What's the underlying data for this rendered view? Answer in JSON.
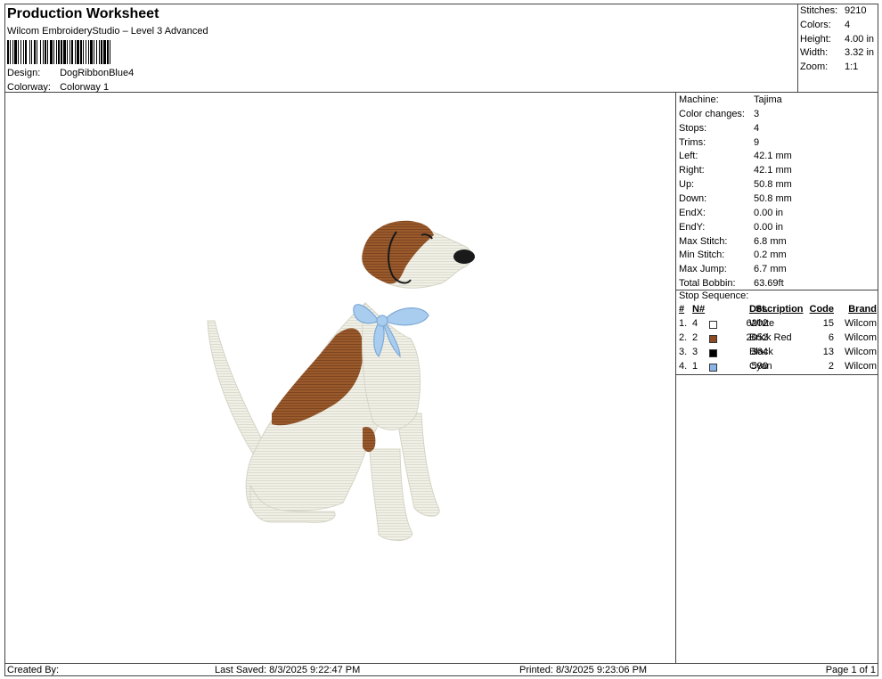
{
  "header": {
    "title": "Production Worksheet",
    "subtitle": "Wilcom EmbroideryStudio – Level 3 Advanced",
    "design_label": "Design:",
    "design_value": "DogRibbonBlue4",
    "colorway_label": "Colorway:",
    "colorway_value": "Colorway 1"
  },
  "stats": [
    {
      "label": "Stitches:",
      "value": "9210"
    },
    {
      "label": "Colors:",
      "value": "4"
    },
    {
      "label": "Height:",
      "value": "4.00 in"
    },
    {
      "label": "Width:",
      "value": "3.32 in"
    },
    {
      "label": "Zoom:",
      "value": "1:1"
    }
  ],
  "machine_info": [
    {
      "label": "Machine:",
      "value": "Tajima"
    },
    {
      "label": "Color changes:",
      "value": "3"
    },
    {
      "label": "Stops:",
      "value": "4"
    },
    {
      "label": "Trims:",
      "value": "9"
    },
    {
      "label": "Left:",
      "value": "42.1 mm"
    },
    {
      "label": "Right:",
      "value": "42.1 mm"
    },
    {
      "label": "Up:",
      "value": "50.8 mm"
    },
    {
      "label": "Down:",
      "value": "50.8 mm"
    },
    {
      "label": "EndX:",
      "value": "0.00 in"
    },
    {
      "label": "EndY:",
      "value": "0.00 in"
    },
    {
      "label": "Max Stitch:",
      "value": "6.8 mm"
    },
    {
      "label": "Min Stitch:",
      "value": "0.2 mm"
    },
    {
      "label": "Max Jump:",
      "value": "6.7 mm"
    },
    {
      "label": "Total Bobbin:",
      "value": "63.69ft"
    }
  ],
  "stop_sequence": {
    "title": "Stop Sequence:",
    "headers": {
      "idx": "#",
      "n": "N#",
      "st": "St.",
      "desc": "Description",
      "code": "Code",
      "brand": "Brand"
    },
    "rows": [
      {
        "idx": "1.",
        "n": "4",
        "color": "#ffffff",
        "st": "6202",
        "desc": "White",
        "code": "15",
        "brand": "Wilcom"
      },
      {
        "idx": "2.",
        "n": "2",
        "color": "#8b4a22",
        "st": "2052",
        "desc": "Brick Red",
        "code": "6",
        "brand": "Wilcom"
      },
      {
        "idx": "3.",
        "n": "3",
        "color": "#000000",
        "st": "364",
        "desc": "Black",
        "code": "13",
        "brand": "Wilcom"
      },
      {
        "idx": "4.",
        "n": "1",
        "color": "#8ab4e8",
        "st": "590",
        "desc": "Cyan",
        "code": "2",
        "brand": "Wilcom"
      }
    ]
  },
  "footer": {
    "created_by": "Created By:",
    "last_saved": "Last Saved: 8/3/2025 9:22:47 PM",
    "printed": "Printed: 8/3/2025 9:23:06 PM",
    "page": "Page 1 of 1"
  },
  "colors": {
    "white_thread": "#f1f0e6",
    "brown_thread": "#9a5a2c",
    "black_thread": "#1a1a1a",
    "cyan_thread": "#a9cdee"
  }
}
